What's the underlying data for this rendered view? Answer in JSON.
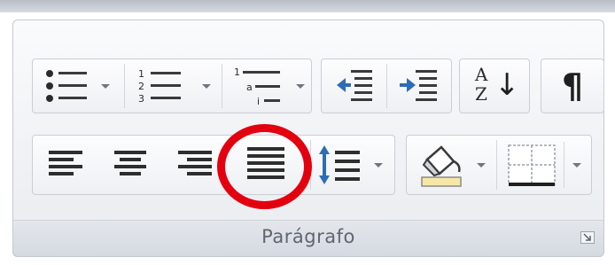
{
  "group": {
    "label": "Parágrafo"
  },
  "buttons": {
    "bullets": "bullets-list-icon",
    "numbering": "numbered-list-icon",
    "multilevel": "multilevel-list-icon",
    "decrease_indent": "decrease-indent-icon",
    "increase_indent": "increase-indent-icon",
    "sort": "sort-az-icon",
    "show_marks": "pilcrow-icon",
    "align_left": "align-left-icon",
    "center": "align-center-icon",
    "align_right": "align-right-icon",
    "justify": "justify-icon",
    "line_spacing": "line-spacing-icon",
    "shading": "shading-bucket-icon",
    "borders": "borders-icon"
  },
  "sort_glyphs": {
    "top": "A",
    "bottom": "Z",
    "arrow": "↓"
  },
  "pilcrow": "¶",
  "list_glyphs": {
    "n1": "1",
    "n2": "2",
    "n3": "3",
    "a": "a",
    "i": "i"
  },
  "colors": {
    "highlight": "#e3000f",
    "icon": "#2b2b2b",
    "shading_fill": "#f7e7a6"
  }
}
